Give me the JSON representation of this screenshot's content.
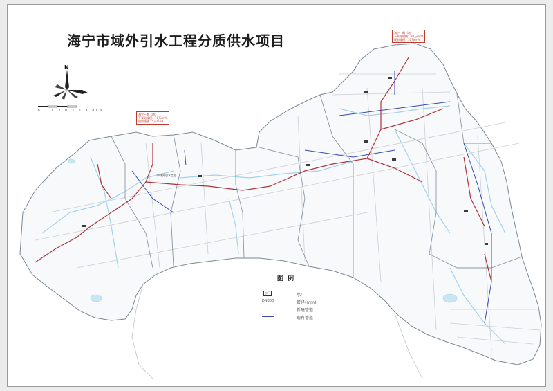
{
  "map": {
    "title": "海宁市域外引水工程分质供水项目",
    "north_label": "N",
    "scale_label": "0   1.0  2.0  3.0  4.0km",
    "colors": {
      "land": "#f7f9fa",
      "district_border": "#7a8793",
      "river": "#9fd3ec",
      "new_pipe": "#b0323c",
      "existing_pipe": "#3a48b3",
      "road": "#c9cfd6",
      "estuary": "#ffffff"
    },
    "callouts": [
      {
        "lines": [
          "海宁一期（南）",
          "下泵站规模：10万m³/d",
          "规划规模：5万m³/d"
        ]
      },
      {
        "lines": [
          "海宁一期（北）",
          "下泵站规模：20万m³/d",
          "规划规模：10万m³/d"
        ]
      }
    ],
    "area_label": "市域外引水工程",
    "legend": {
      "title": "图例",
      "plant_symbol": "水厂",
      "plant_label": "水厂",
      "pipe_size": "DN800",
      "pipe_size_label": "管径(mm)",
      "new_pipe_label": "新建管道",
      "existing_pipe_label": "现有管道"
    }
  }
}
